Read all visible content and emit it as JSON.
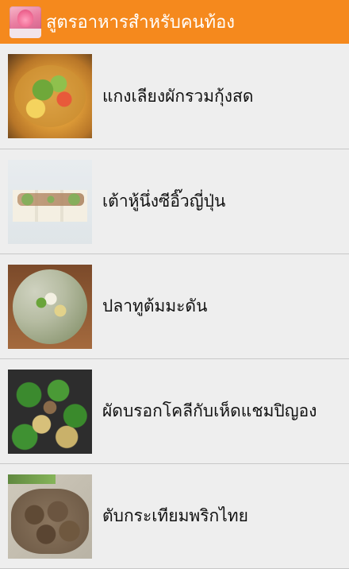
{
  "app": {
    "title": "สูตรอาหารสำหรับคนท้อง"
  },
  "recipes": [
    {
      "label": "แกงเลียงผักรวมกุ้งสด"
    },
    {
      "label": "เต้าหู้นึ่งซีอิ๊วญี่ปุ่น"
    },
    {
      "label": "ปลาทูต้มมะดัน"
    },
    {
      "label": "ผัดบรอกโคลีกับเห็ดแชมปิญอง"
    },
    {
      "label": "ตับกระเทียมพริกไทย"
    }
  ]
}
